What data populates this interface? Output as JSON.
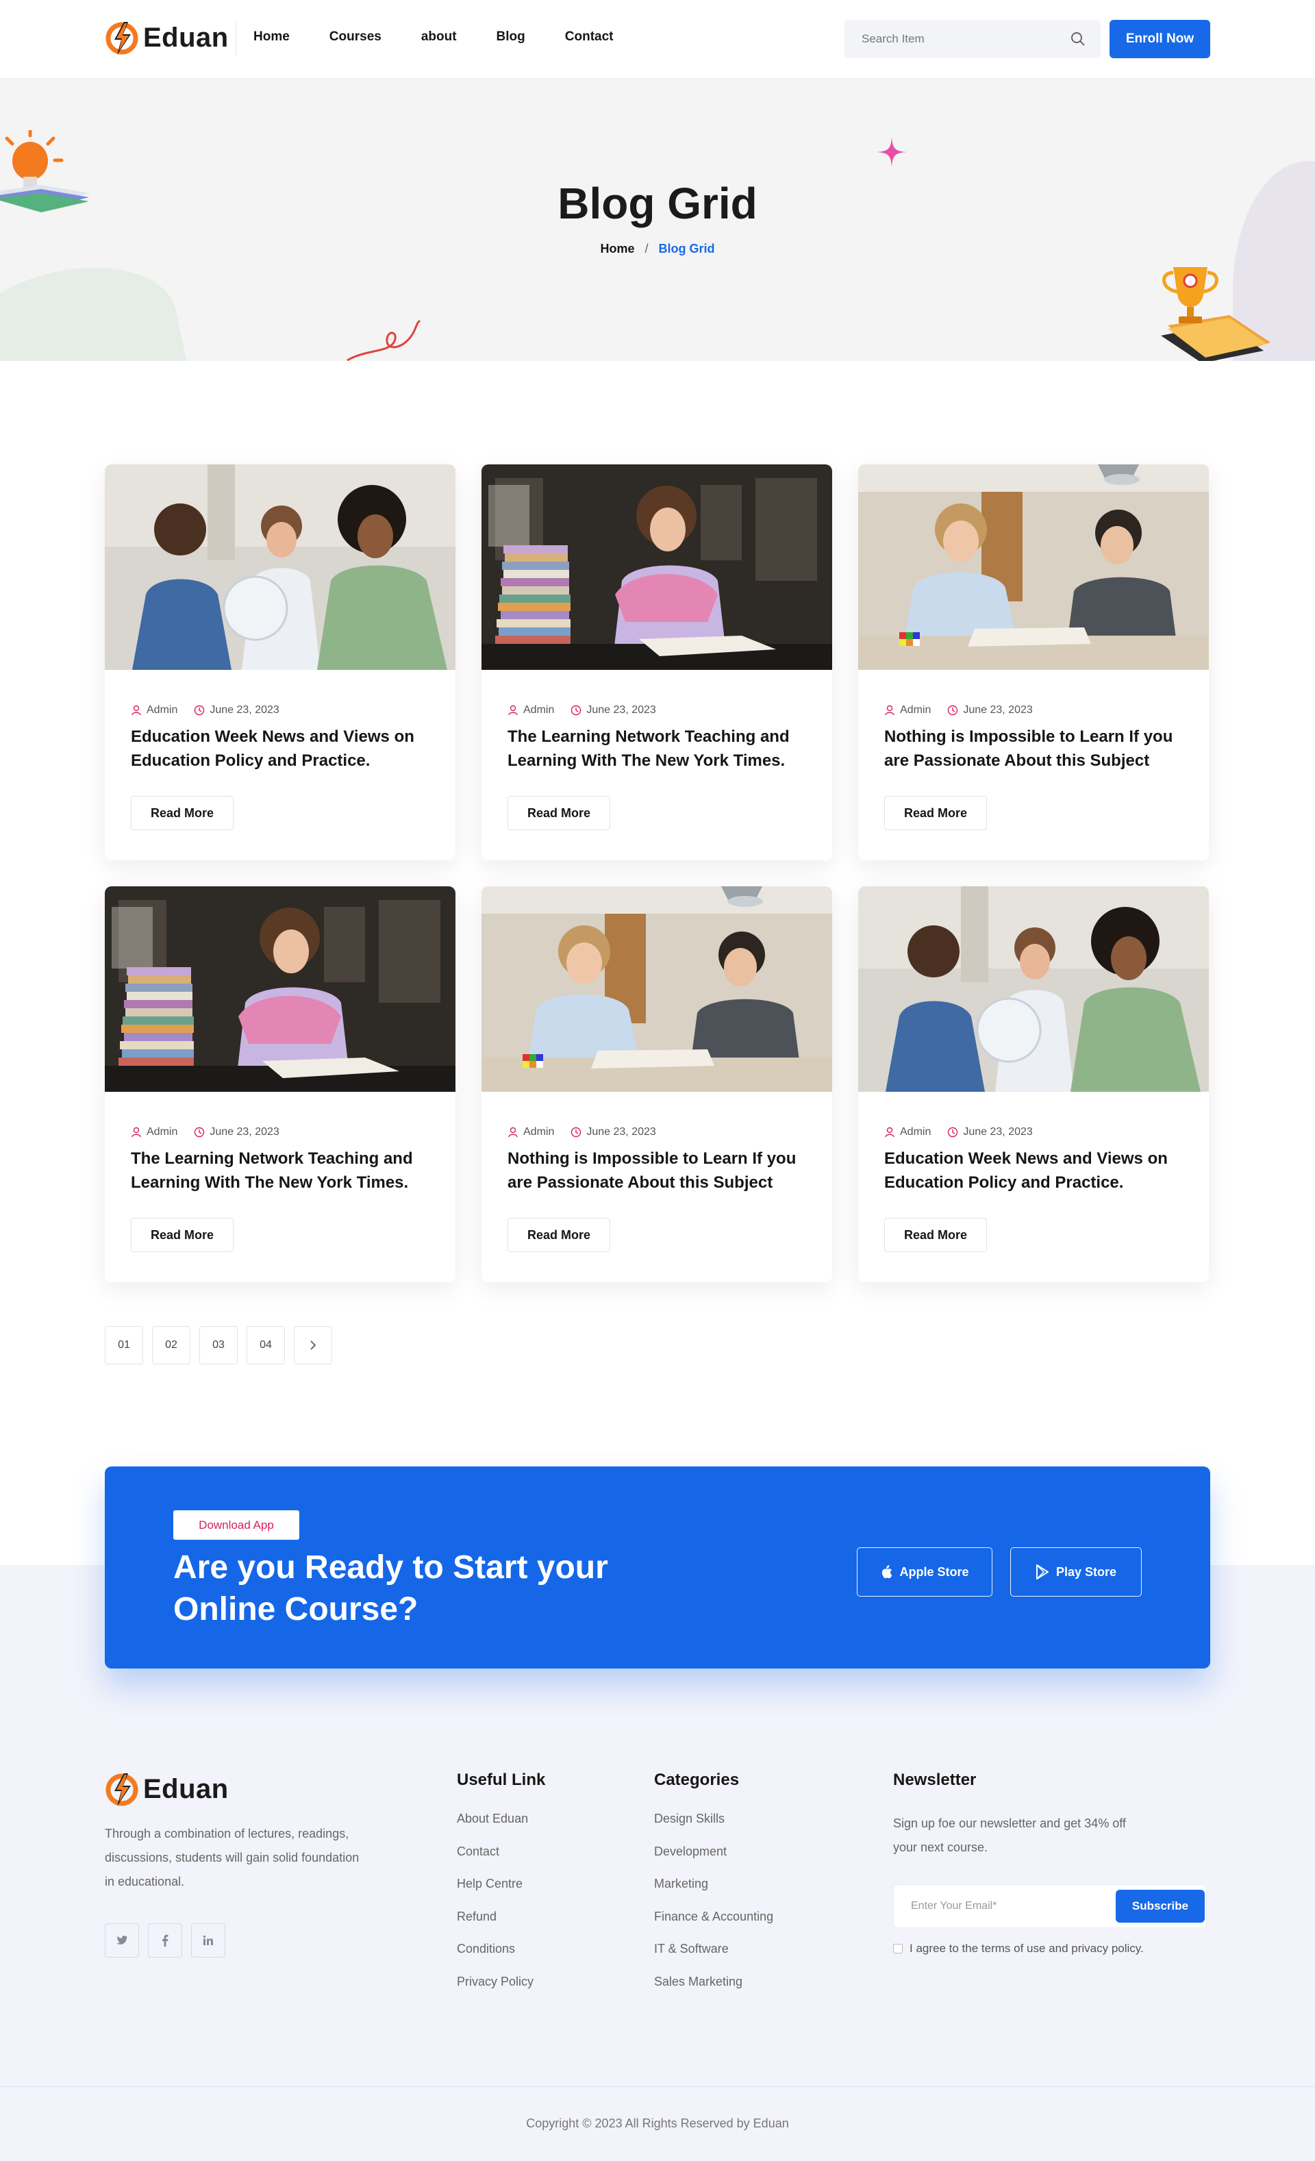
{
  "header": {
    "brand": "Eduan",
    "nav": [
      "Home",
      "Courses",
      "about",
      "Blog",
      "Contact"
    ],
    "search_placeholder": "Search Item",
    "enroll_label": "Enroll Now"
  },
  "hero": {
    "title": "Blog Grid",
    "breadcrumb_home": "Home",
    "breadcrumb_sep": "/",
    "breadcrumb_current": "Blog Grid"
  },
  "posts": [
    {
      "author": "Admin",
      "date": "June 23, 2023",
      "title": "Education Week News and Views on Education Policy and Practice.",
      "cta": "Read More",
      "image": "globe-classroom"
    },
    {
      "author": "Admin",
      "date": "June 23, 2023",
      "title": "The Learning Network Teaching and Learning With The New York Times.",
      "cta": "Read More",
      "image": "library-student"
    },
    {
      "author": "Admin",
      "date": "June 23, 2023",
      "title": "Nothing is Impossible to Learn If you are Passionate About this Subject",
      "cta": "Read More",
      "image": "two-students"
    },
    {
      "author": "Admin",
      "date": "June 23, 2023",
      "title": "The Learning Network Teaching and Learning With The New York Times.",
      "cta": "Read More",
      "image": "library-student"
    },
    {
      "author": "Admin",
      "date": "June 23, 2023",
      "title": "Nothing is Impossible to Learn If you are Passionate About this Subject",
      "cta": "Read More",
      "image": "two-students"
    },
    {
      "author": "Admin",
      "date": "June 23, 2023",
      "title": "Education Week News and Views on Education Policy and Practice.",
      "cta": "Read More",
      "image": "globe-classroom"
    }
  ],
  "pagination": {
    "pages": [
      "01",
      "02",
      "03",
      "04"
    ],
    "next_icon": "chevron-right-icon"
  },
  "cta": {
    "tag": "Download App",
    "heading": "Are you Ready to Start your Online Course?",
    "apple_label": "Apple Store",
    "play_label": "Play Store"
  },
  "footer": {
    "brand": "Eduan",
    "description": "Through a combination of lectures, readings, discussions, students will gain solid foundation in educational.",
    "social": [
      "twitter-icon",
      "facebook-icon",
      "linkedin-icon"
    ],
    "useful": {
      "title": "Useful Link",
      "links": [
        "About Eduan",
        "Contact",
        "Help Centre",
        "Refund",
        "Conditions",
        "Privacy Policy"
      ]
    },
    "categories": {
      "title": "Categories",
      "links": [
        "Design Skills",
        "Development",
        "Marketing",
        "Finance & Accounting",
        "IT & Software",
        "Sales Marketing"
      ]
    },
    "newsletter": {
      "title": "Newsletter",
      "text": "Sign up foe our newsletter and get 34% off your next course.",
      "placeholder": "Enter Your Email*",
      "subscribe_label": "Subscribe",
      "agree_text": "I agree to the terms of use and privacy policy."
    },
    "copyright": "Copyright © 2023 All Rights Reserved by Eduan"
  },
  "colors": {
    "primary": "#1869e8",
    "accent_pink": "#d61f62",
    "logo_orange": "#f47a1f",
    "footer_bg": "#f2f3fb"
  }
}
